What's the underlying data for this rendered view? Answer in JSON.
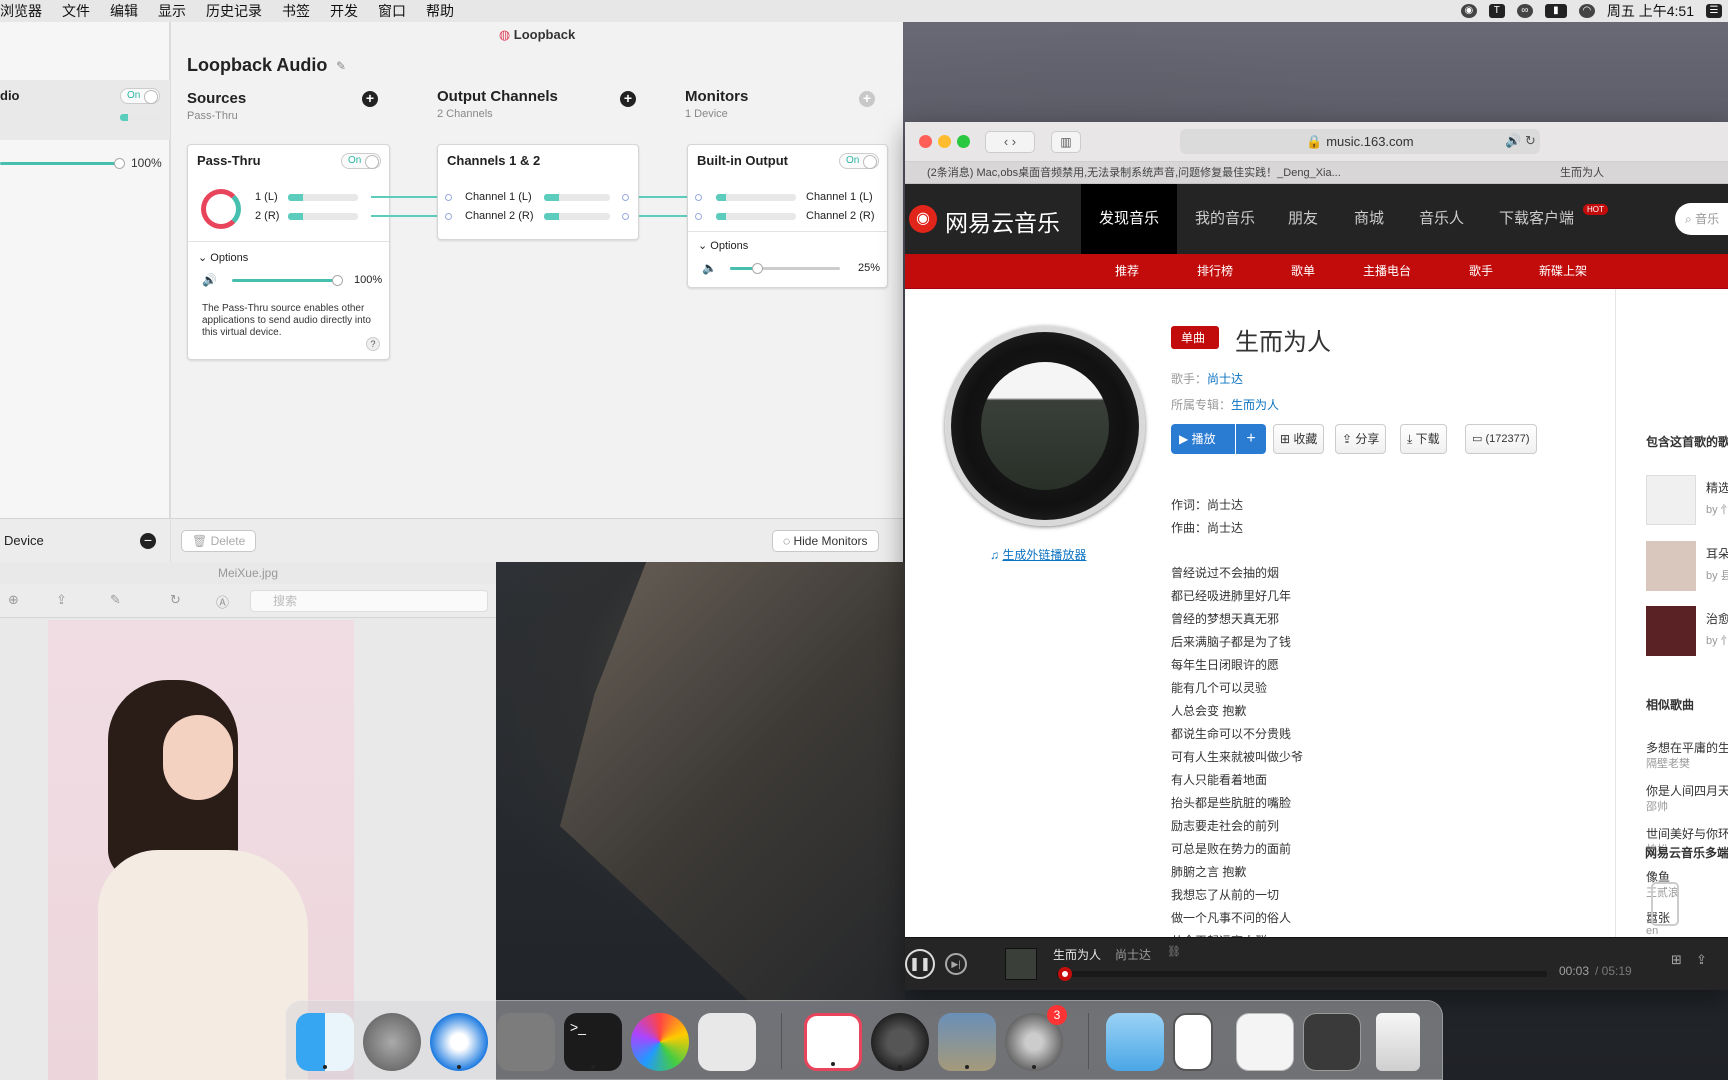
{
  "menubar": {
    "items": [
      "浏览器",
      "文件",
      "编辑",
      "显示",
      "历史记录",
      "书签",
      "开发",
      "窗口",
      "帮助"
    ],
    "clock": "周五 上午4:51"
  },
  "loopback_sidebar": {
    "device_name_partial": "dio",
    "toggle": "On",
    "volume": "100%",
    "device_label": "Device"
  },
  "loopback": {
    "window_title": "Loopback",
    "device_title": "Loopback Audio",
    "sources": {
      "title": "Sources",
      "subtitle": "Pass-Thru"
    },
    "output_channels": {
      "title": "Output Channels",
      "subtitle": "2 Channels"
    },
    "monitors": {
      "title": "Monitors",
      "subtitle": "1 Device"
    },
    "passthru_card": {
      "title": "Pass-Thru",
      "toggle": "On",
      "ch1": "1 (L)",
      "ch2": "2 (R)",
      "options": "Options",
      "volume": "100%",
      "description": "The Pass-Thru source enables other applications to send audio directly into this virtual device.",
      "help": "?"
    },
    "channels_card": {
      "title": "Channels 1 & 2",
      "ch1": "Channel 1 (L)",
      "ch2": "Channel 2 (R)"
    },
    "output_card": {
      "title": "Built-in Output",
      "toggle": "On",
      "ch1": "Channel 1 (L)",
      "ch2": "Channel 2 (R)",
      "options": "Options",
      "volume": "25%"
    },
    "delete_button": "Delete",
    "hide_monitors_button": "Hide Monitors"
  },
  "preview": {
    "title": "MeiXue.jpg",
    "search_placeholder": "搜索"
  },
  "safari": {
    "url": "music.163.com",
    "tabs": [
      "(2条消息) Mac,obs桌面音频禁用,无法录制系统声音,问题修复最佳实践！_Deng_Xia...",
      "生而为人"
    ],
    "netease": {
      "logo": "网易云音乐",
      "nav": [
        "发现音乐",
        "我的音乐",
        "朋友",
        "商城",
        "音乐人",
        "下载客户端"
      ],
      "hot": "HOT",
      "search_placeholder": "音乐",
      "subnav": [
        "推荐",
        "排行榜",
        "歌单",
        "主播电台",
        "歌手",
        "新碟上架"
      ],
      "song": {
        "tag": "单曲",
        "title": "生而为人",
        "singer_label": "歌手：",
        "singer": "尚士达",
        "album_label": "所属专辑：",
        "album": "生而为人",
        "play": "播放",
        "collect": "收藏",
        "share": "分享",
        "download": "下载",
        "comments": "(172377)",
        "gen_link": "生成外链播放器"
      },
      "credits": [
        "作词：尚士达",
        "作曲：尚士达"
      ],
      "lyrics": [
        "曾经说过不会抽的烟",
        "都已经吸进肺里好几年",
        "曾经的梦想天真无邪",
        "后来满脑子都是为了钱",
        "每年生日闭眼许的愿",
        "能有几个可以灵验",
        "人总会变 抱歉",
        "都说生命可以不分贵贱",
        "可有人生来就被叫做少爷",
        "有人只能看着地面",
        "抬头都是些肮脏的嘴脸",
        "励志要走社会的前列",
        "可总是败在势力的面前",
        "肺腑之言 抱歉",
        "我想忘了从前的一切",
        "做一个凡事不问的俗人",
        "从今天起远离人群"
      ],
      "side": {
        "playlist_title": "包含这首歌的歌",
        "playlists": [
          {
            "name": "精选",
            "by": "by 忄"
          },
          {
            "name": "耳朵",
            "by": "by 县"
          },
          {
            "name": "治愈",
            "by": "by 忄"
          }
        ],
        "similar_title": "相似歌曲",
        "similar": [
          {
            "name": "多想在平庸的生",
            "artist": "隔壁老樊"
          },
          {
            "name": "你是人间四月天",
            "artist": "邵帅"
          },
          {
            "name": "世间美好与你环",
            "artist": "柏松"
          },
          {
            "name": "像鱼",
            "artist": "王贰浪"
          },
          {
            "name": "嚣张",
            "artist": "en"
          }
        ],
        "multi_title": "网易云音乐多端"
      },
      "player": {
        "song": "生而为人",
        "artist": "尚士达",
        "time": "00:03",
        "total": "/ 05:19",
        "progress": 0.01
      }
    }
  },
  "dock": {
    "badge": "3"
  }
}
